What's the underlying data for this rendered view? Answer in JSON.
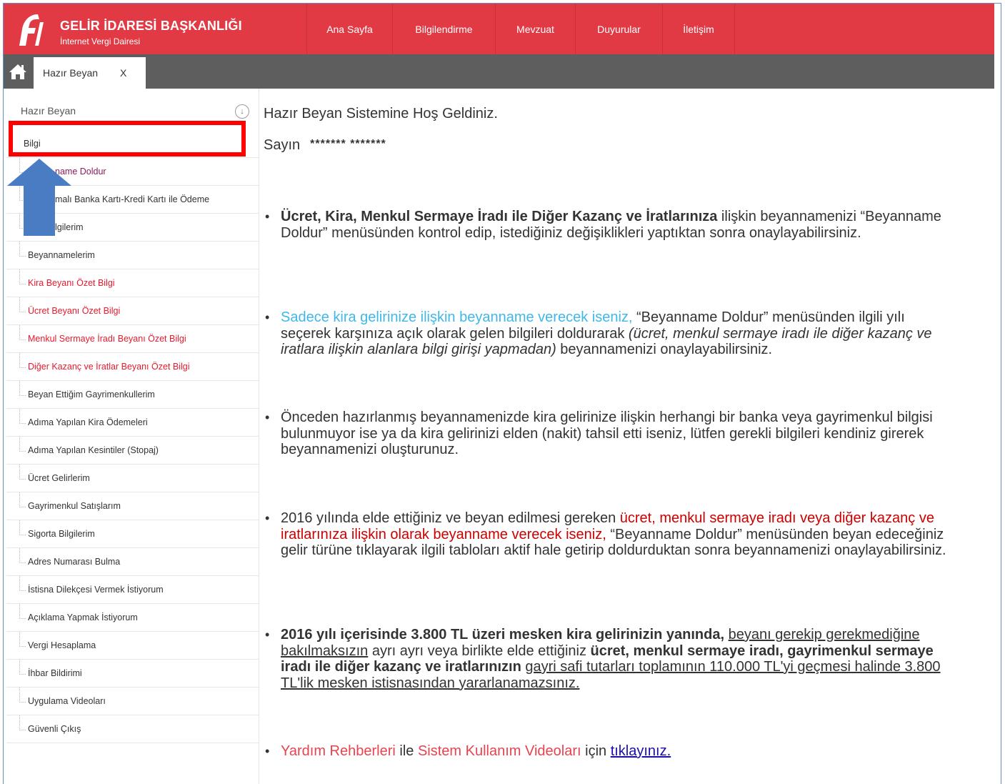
{
  "brand": {
    "title": "GELİR İDARESİ BAŞKANLIĞI",
    "subtitle": "İnternet Vergi Dairesi"
  },
  "nav": [
    {
      "label": "Ana Sayfa"
    },
    {
      "label": "Bilgilendirme"
    },
    {
      "label": "Mevzuat"
    },
    {
      "label": "Duyurular"
    },
    {
      "label": "İletişim"
    }
  ],
  "tab": {
    "label": "Hazır Beyan",
    "close": "X"
  },
  "sidebar": {
    "header": "Hazır Beyan",
    "items": [
      {
        "label": "Bilgi"
      },
      {
        "label": "Beyanname Doldur",
        "visible": "name Doldur"
      },
      {
        "label": "Anlaşmalı Banka Kartı-Kredi Kartı ile Ödeme",
        "visible": "malı Banka Kartı-Kredi Kartı ile Ödeme"
      },
      {
        "label": "Bilgilerim",
        "visible": "lgilerim"
      },
      {
        "label": "Beyannamelerim"
      },
      {
        "label": "Kira Beyanı Özet Bilgi"
      },
      {
        "label": "Ücret Beyanı Özet Bilgi"
      },
      {
        "label": "Menkul Sermaye İradı Beyanı Özet Bilgi"
      },
      {
        "label": "Diğer Kazanç ve İratlar Beyanı Özet Bilgi"
      },
      {
        "label": "Beyan Ettiğim Gayrimenkullerim"
      },
      {
        "label": "Adıma Yapılan Kira Ödemeleri"
      },
      {
        "label": "Adıma Yapılan Kesintiler (Stopaj)"
      },
      {
        "label": "Ücret Gelirlerim"
      },
      {
        "label": "Gayrimenkul Satışlarım"
      },
      {
        "label": "Sigorta Bilgilerim"
      },
      {
        "label": "Adres Numarası Bulma"
      },
      {
        "label": "İstisna Dilekçesi Vermek İstiyorum"
      },
      {
        "label": "Açıklama Yapmak İstiyorum"
      },
      {
        "label": "Vergi Hesaplama"
      },
      {
        "label": "İhbar Bildirimi"
      },
      {
        "label": "Uygulama Videoları"
      },
      {
        "label": "Güvenli Çıkış"
      }
    ]
  },
  "main": {
    "welcome": "Hazır Beyan Sistemine Hoş Geldiniz.",
    "greeting": "Sayın",
    "masked_name": "******* *******",
    "p1": {
      "bold": "Ücret, Kira, Menkul Sermaye İradı ile Diğer Kazanç ve İratlarınıza",
      "rest": " ilişkin beyannamenizi “Beyanname Doldur” menüsünden kontrol edip, istediğiniz değişiklikleri yaptıktan sonra onaylayabilirsiniz."
    },
    "p2": {
      "cyan": "Sadece kira gelirinize ilişkin beyanname verecek iseniz,",
      "mid": " “Beyanname Doldur” menüsünden ilgili yılı seçerek karşınıza açık olarak gelen bilgileri doldurarak ",
      "italic": "(ücret, menkul sermaye iradı ile diğer kazanç ve iratlara ilişkin alanlara bilgi girişi yapmadan)",
      "end": " beyannamenizi onaylayabilirsiniz."
    },
    "p3": "Önceden hazırlanmış beyannamenizde kira gelirinize ilişkin herhangi bir banka veya gayrimenkul bilgisi bulunmuyor ise ya da kira gelirinizi elden (nakit) tahsil etti iseniz, lütfen gerekli bilgileri kendiniz girerek beyannamenizi oluşturunuz.",
    "p4": {
      "start": "2016 yılında elde ettiğiniz ve beyan edilmesi gereken ",
      "red": "ücret, menkul sermaye iradı veya diğer kazanç ve iratlarınıza ilişkin olarak beyanname verecek iseniz,",
      "end": " “Beyanname Doldur” menüsünden beyan edeceğiniz gelir türüne tıklayarak ilgili tabloları aktif hale getirip doldurduktan sonra beyannamenizi onaylayabilirsiniz."
    },
    "p5": {
      "bold1": "2016 yılı içerisinde 3.800 TL üzeri mesken kira gelirinizin yanında,",
      "ul1": "beyanı gerekip gerekmediğine bakılmaksızın",
      "mid": " ayrı ayrı veya birlikte elde ettiğiniz ",
      "bold2": "ücret, menkul sermaye iradı, gayrimenkul sermaye iradı ile diğer kazanç ve iratlarınızın",
      "ul2": "gayri safi tutarları toplamının 110.000 TL'yi geçmesi halinde 3.800 TL'lik mesken istisnasından yararlanamazsınız."
    },
    "p6": {
      "pink1": "Yardım Rehberleri",
      "mid1": " ile ",
      "pink2": "Sistem Kullanım Videoları",
      "mid2": " için ",
      "link": "tıklayınız."
    }
  },
  "colors": {
    "header_red": "#e23a45",
    "tabbar_gray": "#5e5e5e",
    "highlight": "#ff0000",
    "arrow_blue": "#4a7cc4",
    "menu_red": "#e8192c"
  }
}
